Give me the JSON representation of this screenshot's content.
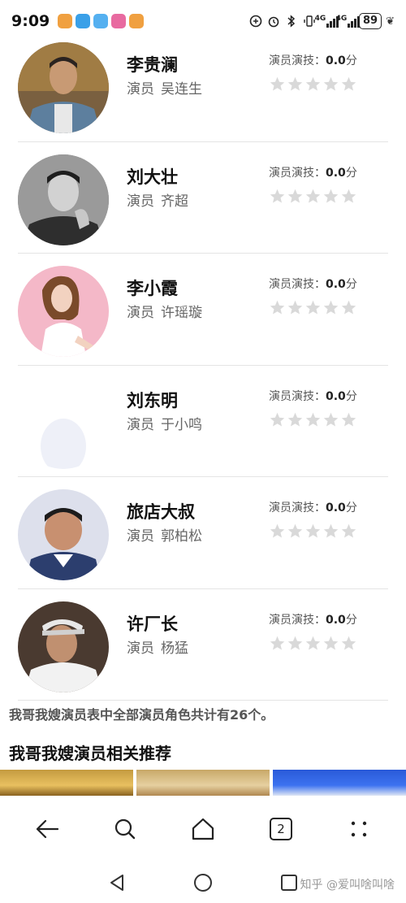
{
  "status_bar": {
    "time": "9:09",
    "network_1": "4G",
    "network_2": "4G",
    "battery": "89"
  },
  "cast": [
    {
      "role": "李贵澜",
      "prefix": "演员",
      "actor": "吴连生",
      "rating_label": "演员演技：",
      "rating_value": "0.0",
      "rating_unit": "分",
      "stars": 0
    },
    {
      "role": "刘大壮",
      "prefix": "演员",
      "actor": "齐超",
      "rating_label": "演员演技：",
      "rating_value": "0.0",
      "rating_unit": "分",
      "stars": 0
    },
    {
      "role": "李小霞",
      "prefix": "演员",
      "actor": "许瑶璇",
      "rating_label": "演员演技：",
      "rating_value": "0.0",
      "rating_unit": "分",
      "stars": 0
    },
    {
      "role": "刘东明",
      "prefix": "演员",
      "actor": "于小鸣",
      "rating_label": "演员演技：",
      "rating_value": "0.0",
      "rating_unit": "分",
      "stars": 0
    },
    {
      "role": "旅店大叔",
      "prefix": "演员",
      "actor": "郭柏松",
      "rating_label": "演员演技：",
      "rating_value": "0.0",
      "rating_unit": "分",
      "stars": 0
    },
    {
      "role": "许厂长",
      "prefix": "演员",
      "actor": "杨猛",
      "rating_label": "演员演技：",
      "rating_value": "0.0",
      "rating_unit": "分",
      "stars": 0
    }
  ],
  "summary": "我哥我嫂演员表中全部演员角色共计有26个。",
  "related_title": "我哥我嫂演员相关推荐",
  "browser_toolbar": {
    "tab_count": "2"
  },
  "watermark": "知乎 @爱叫啥叫啥",
  "colors": {
    "star_empty": "#d9d9d9",
    "divider": "#e4e4e4"
  }
}
